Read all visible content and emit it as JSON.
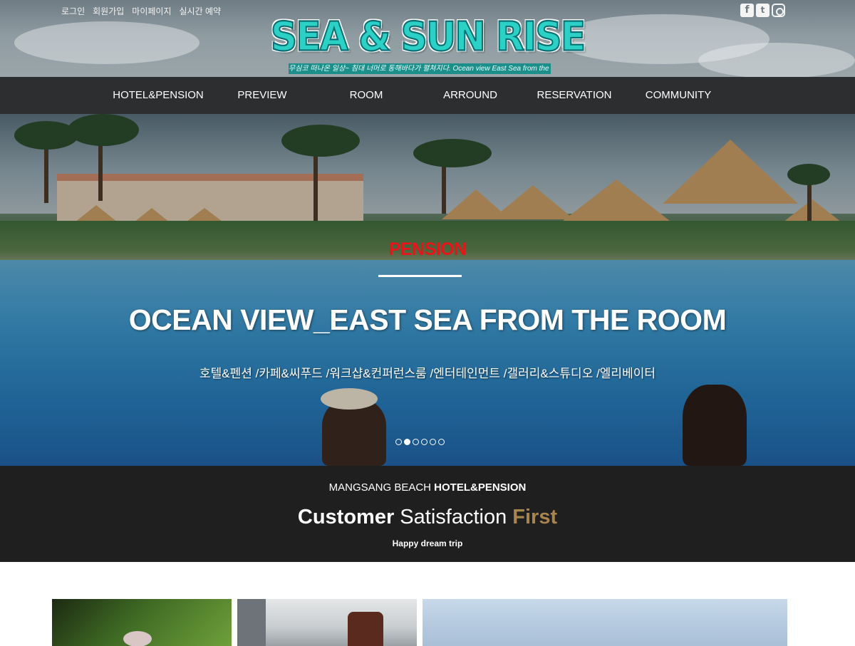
{
  "util_links": [
    "로그인",
    "회원가입",
    "마이페이지",
    "실시간 예약"
  ],
  "social": [
    "facebook-icon",
    "twitter-icon",
    "instagram-icon"
  ],
  "logo": {
    "title": "SEA & SUN RISE",
    "tagline": "무심코 떠나온 일상~ 침대 너머로 동해바다가 펼쳐지다. Ocean view East Sea from the room"
  },
  "nav": [
    "HOTEL&PENSION",
    "PREVIEW",
    "ROOM",
    "ARROUND",
    "RESERVATION",
    "COMMUNITY"
  ],
  "hero": {
    "kicker": "PENSION",
    "headline": "OCEAN VIEW_EAST SEA FROM THE ROOM",
    "subline": "호텔&펜션 /카페&씨푸드 /워크샵&컨퍼런스룸 /엔터테인먼트 /갤러리&스튜디오 /엘리베이터",
    "slides": 6,
    "active_slide": 2
  },
  "band": {
    "line1_pre": "MANGSANG BEACH ",
    "line1_bold": "HOTEL&PENSION",
    "line2_w1": "Customer",
    "line2_w2": " Satisfaction ",
    "line2_w3": "First",
    "line3": "Happy dream trip"
  },
  "colors": {
    "nav_bg": "#2c2e30",
    "band_bg": "#1f1f1f",
    "accent_gold": "#a8844f",
    "kicker_red": "#e8141a",
    "logo_teal": "#2ad1c4"
  }
}
